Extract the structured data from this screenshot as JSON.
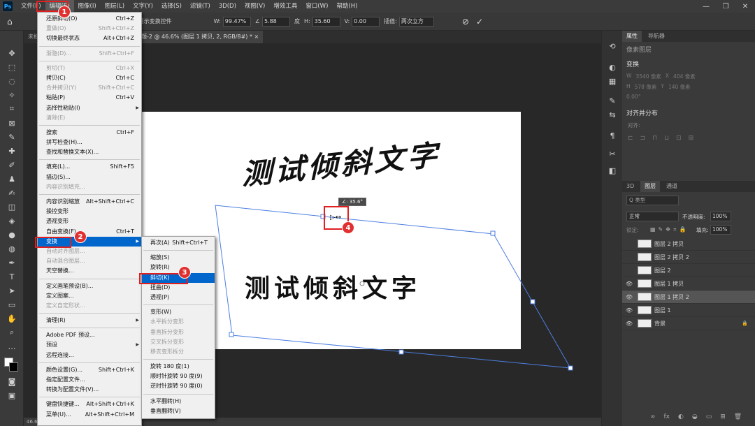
{
  "menubar": {
    "logo": "Ps",
    "items": [
      "文件(F)",
      "编辑(E)",
      "图像(I)",
      "图层(L)",
      "文字(Y)",
      "选择(S)",
      "滤镜(T)",
      "3D(D)",
      "视图(V)",
      "增效工具",
      "窗口(W)",
      "帮助(H)"
    ],
    "win": [
      "—",
      "❐",
      "✕"
    ]
  },
  "options": {
    "w_label": "W:",
    "w_value": "99.47%",
    "h_label": "H:",
    "h_value": "35.60",
    "angle_value": "5.88",
    "angle_unit": "度",
    "v_label": "V:",
    "v_value": "0.00",
    "interp_label": "插值:",
    "interp_value": "两次立方",
    "partial_label": "用示变换控件",
    "cancel_icon": "⊘",
    "commit_icon": "✓"
  },
  "tabs": {
    "tab1": "未标题-1",
    "tab2": "标题-2 @ 46.6% (图层 1 拷贝, 2, RGB/8#) *",
    "close": "×"
  },
  "canvas": {
    "text_top": "测试倾斜文字",
    "text_bottom": "测试倾斜文字",
    "tooltip": "∠: 35.6°"
  },
  "status": "46.61%",
  "edit_menu": [
    {
      "label": "还原斜切(O)",
      "sc": "Ctrl+Z"
    },
    {
      "label": "重做(O)",
      "sc": "Shift+Ctrl+Z",
      "dis": true
    },
    {
      "label": "切换最终状态",
      "sc": "Alt+Ctrl+Z",
      "sep": true
    },
    {
      "label": "渐隐(D)...",
      "sc": "Shift+Ctrl+F",
      "dis": true,
      "sep": true
    },
    {
      "label": "剪切(T)",
      "sc": "Ctrl+X",
      "dis": true
    },
    {
      "label": "拷贝(C)",
      "sc": "Ctrl+C"
    },
    {
      "label": "合并拷贝(Y)",
      "sc": "Shift+Ctrl+C",
      "dis": true
    },
    {
      "label": "粘贴(P)",
      "sc": "Ctrl+V"
    },
    {
      "label": "选择性粘贴(I)",
      "sc": "",
      "arrow": true
    },
    {
      "label": "清除(E)",
      "sc": "",
      "dis": true,
      "sep": true
    },
    {
      "label": "搜索",
      "sc": "Ctrl+F"
    },
    {
      "label": "拼写检查(H)...",
      "sc": ""
    },
    {
      "label": "查找和替换文本(X)...",
      "sc": "",
      "sep": true
    },
    {
      "label": "填充(L)...",
      "sc": "Shift+F5"
    },
    {
      "label": "描边(S)...",
      "sc": ""
    },
    {
      "label": "内容识别填充...",
      "sc": "",
      "dis": true,
      "sep": true
    },
    {
      "label": "内容识别缩放",
      "sc": "Alt+Shift+Ctrl+C"
    },
    {
      "label": "操控变形",
      "sc": ""
    },
    {
      "label": "透视变形",
      "sc": ""
    },
    {
      "label": "自由变换(F)",
      "sc": "Ctrl+T"
    },
    {
      "label": "变换",
      "sc": "",
      "arrow": true,
      "hl": true
    },
    {
      "label": "自动对齐图层...",
      "sc": "",
      "dis": true
    },
    {
      "label": "自动混合图层...",
      "sc": "",
      "dis": true
    },
    {
      "label": "天空替换...",
      "sc": "",
      "sep": true
    },
    {
      "label": "定义画笔预设(B)...",
      "sc": ""
    },
    {
      "label": "定义图案...",
      "sc": ""
    },
    {
      "label": "定义自定形状...",
      "sc": "",
      "dis": true,
      "sep": true
    },
    {
      "label": "清理(R)",
      "sc": "",
      "arrow": true,
      "sep": true
    },
    {
      "label": "Adobe PDF 预设...",
      "sc": ""
    },
    {
      "label": "预设",
      "sc": "",
      "arrow": true
    },
    {
      "label": "远程连接...",
      "sc": "",
      "sep": true
    },
    {
      "label": "颜色设置(G)...",
      "sc": "Shift+Ctrl+K"
    },
    {
      "label": "指定配置文件...",
      "sc": ""
    },
    {
      "label": "转换为配置文件(V)...",
      "sc": "",
      "sep": true
    },
    {
      "label": "键盘快捷键...",
      "sc": "Alt+Shift+Ctrl+K"
    },
    {
      "label": "菜单(U)...",
      "sc": "Alt+Shift+Ctrl+M"
    }
  ],
  "transform_menu": [
    {
      "label": "再次(A)",
      "sc": "Shift+Ctrl+T",
      "sep": true
    },
    {
      "label": "缩放(S)",
      "sc": ""
    },
    {
      "label": "旋转(R)",
      "sc": ""
    },
    {
      "label": "斜切(K)",
      "sc": "",
      "hl": true
    },
    {
      "label": "扭曲(D)",
      "sc": ""
    },
    {
      "label": "透视(P)",
      "sc": "",
      "sep": true
    },
    {
      "label": "变形(W)",
      "sc": ""
    },
    {
      "label": "水平拆分变形",
      "sc": "",
      "dis": true
    },
    {
      "label": "垂直拆分变形",
      "sc": "",
      "dis": true
    },
    {
      "label": "交叉拆分变形",
      "sc": "",
      "dis": true
    },
    {
      "label": "移去变形拆分",
      "sc": "",
      "dis": true,
      "sep": true
    },
    {
      "label": "旋转 180 度(1)",
      "sc": ""
    },
    {
      "label": "顺时针旋转 90 度(9)",
      "sc": ""
    },
    {
      "label": "逆时针旋转 90 度(0)",
      "sc": "",
      "sep": true
    },
    {
      "label": "水平翻转(H)",
      "sc": ""
    },
    {
      "label": "垂直翻转(V)",
      "sc": ""
    }
  ],
  "badges": [
    "1",
    "2",
    "3",
    "4"
  ],
  "panel": {
    "tabs": [
      "属性",
      "导航器"
    ],
    "pixel_layer": "像素图层",
    "transform_title": "变换",
    "w_label": "W",
    "w_value": "3540 像素",
    "x_label": "X",
    "x_value": "404 像素",
    "h_label": "H",
    "h_value": "578 像素",
    "y_label": "Y",
    "y_value": "140 像素",
    "angle_value": "0.00°",
    "align_title": "对齐并分布",
    "align_label": "对齐:",
    "layer_tabs": [
      "3D",
      "图层",
      "通道"
    ],
    "kind": "Q 类型",
    "blend": "正常",
    "opacity_label": "不透明度:",
    "opacity": "100%",
    "lock_label": "锁定:",
    "fill_label": "填充:",
    "fill": "100%",
    "layers": [
      {
        "name": "图层 2 拷贝",
        "visible": false
      },
      {
        "name": "图层 2 拷贝 2",
        "visible": false
      },
      {
        "name": "图层 2",
        "visible": false
      },
      {
        "name": "图层 1 拷贝",
        "visible": true
      },
      {
        "name": "图层 1 拷贝 2",
        "visible": true,
        "sel": true
      },
      {
        "name": "图层 1",
        "visible": true
      },
      {
        "name": "背景",
        "visible": true,
        "lock": true
      }
    ],
    "bottom_icons": [
      "∞",
      "fx",
      "◐",
      "◒",
      "▭",
      "⊞",
      "🗑"
    ]
  },
  "colors": {
    "highlight": "#0066cc",
    "annot": "#e02020"
  }
}
